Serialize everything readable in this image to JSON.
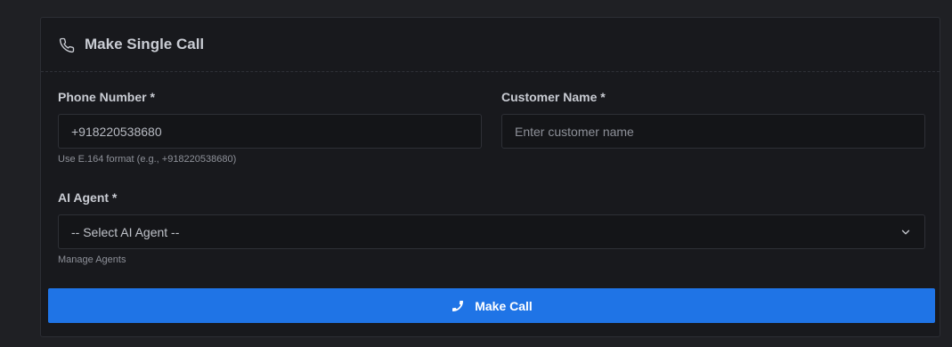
{
  "panel": {
    "title": "Make Single Call",
    "title_icon": "phone-outline-icon"
  },
  "form": {
    "phone": {
      "label": "Phone Number *",
      "value": "+918220538680",
      "hint": "Use E.164 format (e.g., +918220538680)"
    },
    "customer": {
      "label": "Customer Name *",
      "placeholder": "Enter customer name"
    },
    "agent": {
      "label": "AI Agent *",
      "selected": "-- Select AI Agent --",
      "chevron_icon": "chevron-down-icon",
      "hint": "Manage Agents"
    }
  },
  "actions": {
    "make_call_label": "Make Call",
    "make_call_icon": "phone-solid-icon",
    "button_color": "#1f74e6"
  },
  "colors": {
    "page_bg": "#1f2024",
    "card_bg": "#18191d",
    "input_bg": "#141518"
  }
}
